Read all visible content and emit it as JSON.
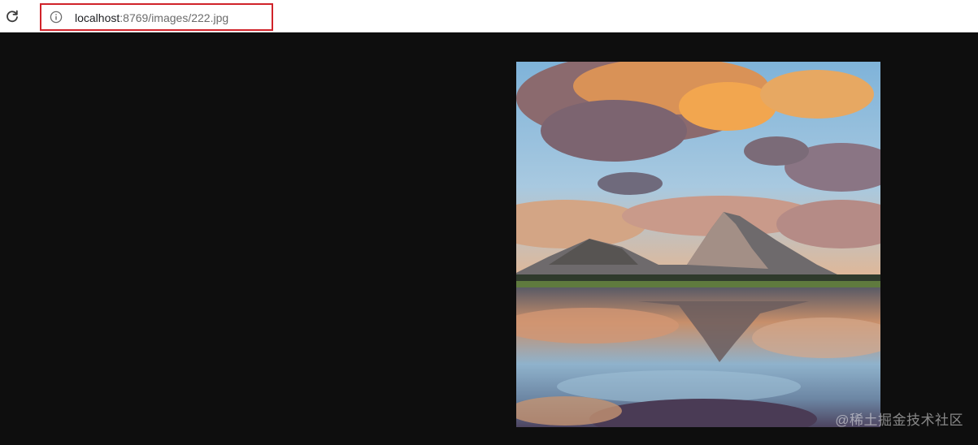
{
  "browser": {
    "url_host": "localhost",
    "url_path": ":8769/images/222.jpg",
    "reload_icon": "reload-icon",
    "info_icon": "info-icon",
    "highlight_color": "#d0232a"
  },
  "viewer": {
    "background_color": "#0e0e0e",
    "image_description_icon": "mountain-lake-sunset-painting"
  },
  "watermark": {
    "text": "@稀土掘金技术社区"
  }
}
